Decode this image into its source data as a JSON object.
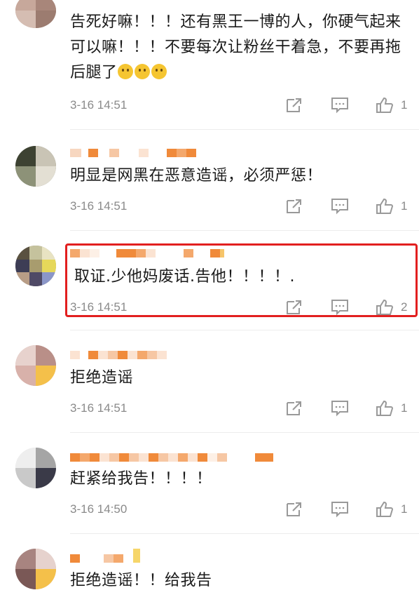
{
  "comments": [
    {
      "text": "告死好嘛！！！还有黑王一博的人，你硬气起来可以嘛！！！不要每次让粉丝干着急，不要再拖后腿了",
      "emoji_count": 3,
      "time": "3-16 14:51",
      "likes": "1"
    },
    {
      "text": "明显是网黑在恶意造谣，必须严惩！",
      "time": "3-16 14:51",
      "likes": "1"
    },
    {
      "text": "取证.少他妈废话.告他！！！！.",
      "time": "3-16 14:51",
      "likes": "2",
      "highlighted": true
    },
    {
      "text": "拒绝造谣",
      "time": "3-16 14:51",
      "likes": "1"
    },
    {
      "text": "赶紧给我告！！！！",
      "time": "3-16 14:50",
      "likes": "1"
    },
    {
      "text": "拒绝造谣！！给我告"
    }
  ],
  "icons": {
    "share": "share-icon",
    "reply": "comment-icon",
    "like": "thumbs-up-icon"
  },
  "colors": {
    "highlight": "#e21f1f",
    "meta": "#8a8a8a",
    "pixelated_name": "#f08a3a"
  }
}
